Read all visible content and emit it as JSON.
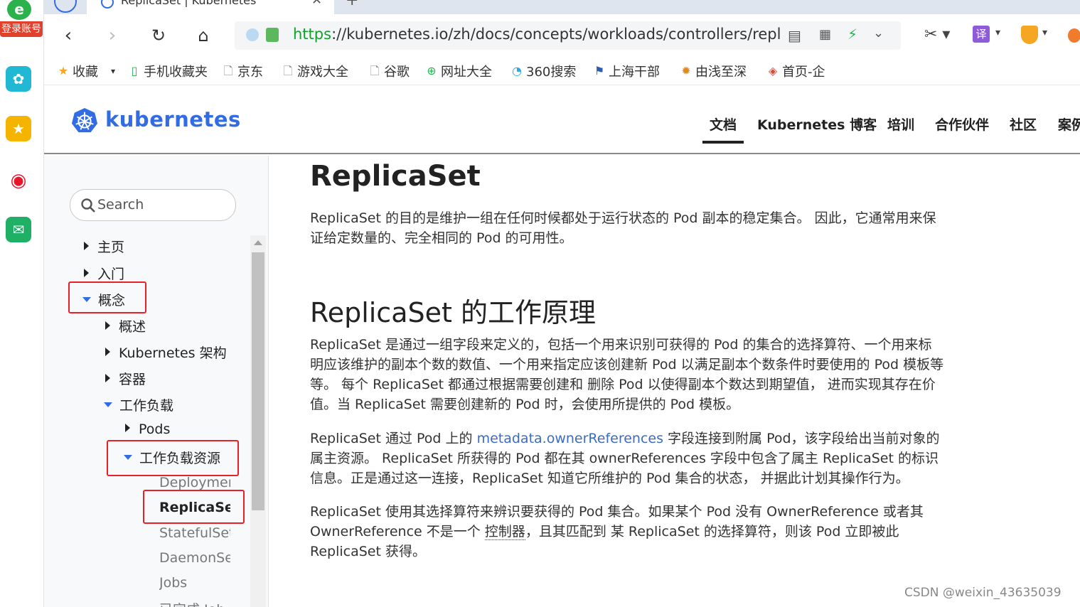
{
  "browser": {
    "tab_title": "ReplicaSet | Kubernetes",
    "url_scheme": "https",
    "url_rest": "://kubernetes.io/zh/docs/concepts/workloads/controllers/repl",
    "login_badge": "登录账号",
    "translate_label": "译"
  },
  "bookmarks": [
    {
      "label": "收藏",
      "icon": "star-icon"
    },
    {
      "label": "手机收藏夹",
      "icon": "phone-icon"
    },
    {
      "label": "京东",
      "icon": "page-icon"
    },
    {
      "label": "游戏大全",
      "icon": "page-icon"
    },
    {
      "label": "谷歌",
      "icon": "page-icon"
    },
    {
      "label": "网址大全",
      "icon": "plus-circle-icon"
    },
    {
      "label": "360搜索",
      "icon": "search-ring-icon"
    },
    {
      "label": "上海干部",
      "icon": "flag-icon"
    },
    {
      "label": "由浅至深",
      "icon": "gear-badge-icon"
    },
    {
      "label": "首页-企",
      "icon": "diamond-icon"
    }
  ],
  "site": {
    "logo_text": "kubernetes",
    "nav": [
      "文档",
      "Kubernetes 博客",
      "培训",
      "合作伙伴",
      "社区",
      "案例"
    ]
  },
  "sidebar": {
    "search_placeholder": "Search",
    "items": {
      "home": "主页",
      "getting_started": "入门",
      "concepts": "概念",
      "overview": "概述",
      "architecture": "Kubernetes 架构",
      "containers": "容器",
      "workloads": "工作负载",
      "pods": "Pods",
      "workload_resources": "工作负载资源",
      "deployments": "Deployments",
      "replicaset": "ReplicaSet",
      "statefulsets": "StatefulSets",
      "daemonset": "DaemonSet",
      "jobs": "Jobs",
      "finished_jobs": "已完成 Job"
    }
  },
  "content": {
    "title": "ReplicaSet",
    "intro": "ReplicaSet 的目的是维护一组在任何时候都处于运行状态的 Pod 副本的稳定集合。 因此，它通常用来保证给定数量的、完全相同的 Pod 的可用性。",
    "h2": "ReplicaSet 的工作原理",
    "p1": "ReplicaSet 是通过一组字段来定义的，包括一个用来识别可获得的 Pod 的集合的选择算符、一个用来标明应该维护的副本个数的数值、一个用来指定应该创建新 Pod 以满足副本个数条件时要使用的 Pod 模板等等。 每个 ReplicaSet 都通过根据需要创建和 删除 Pod 以使得副本个数达到期望值， 进而实现其存在价值。当 ReplicaSet 需要创建新的 Pod 时，会使用所提供的 Pod 模板。",
    "p2_before": "ReplicaSet 通过 Pod 上的 ",
    "p2_link": "metadata.ownerReferences",
    "p2_after": " 字段连接到附属 Pod，该字段给出当前对象的属主资源。 ReplicaSet 所获得的 Pod 都在其 ownerReferences 字段中包含了属主 ReplicaSet 的标识信息。正是通过这一连接，ReplicaSet 知道它所维护的 Pod 集合的状态， 并据此计划其操作行为。",
    "p3_before": "ReplicaSet 使用其选择算符来辨识要获得的 Pod 集合。如果某个 Pod 没有 OwnerReference 或者其 OwnerReference 不是一个 ",
    "p3_link": "控制器",
    "p3_after": "，且其匹配到 某 ReplicaSet 的选择算符，则该 Pod 立即被此 ReplicaSet 获得。"
  },
  "watermark": "CSDN @weixin_43635039",
  "colors": {
    "k8s_blue": "#326ce5",
    "highlight_red": "#e8202a",
    "link": "#3b6cc4"
  }
}
